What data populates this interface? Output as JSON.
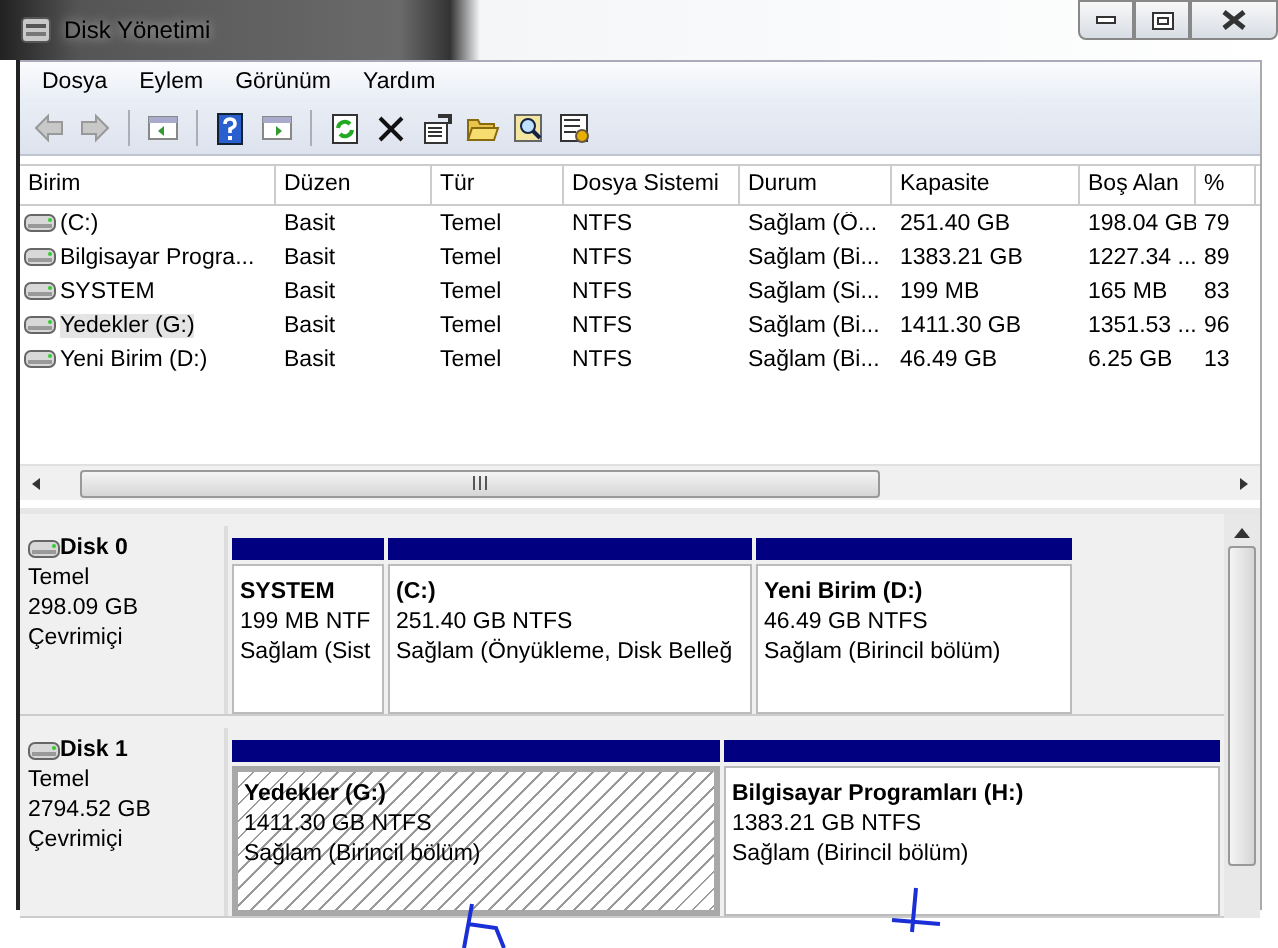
{
  "window": {
    "title": "Disk Yönetimi"
  },
  "menu": [
    "Dosya",
    "Eylem",
    "Görünüm",
    "Yardım"
  ],
  "table": {
    "columns": [
      "Birim",
      "Düzen",
      "Tür",
      "Dosya Sistemi",
      "Durum",
      "Kapasite",
      "Boş Alan",
      "%"
    ],
    "rows": [
      {
        "cells": [
          " (C:)",
          "Basit",
          "Temel",
          "NTFS",
          "Sağlam (Ö...",
          "251.40 GB",
          "198.04 GB",
          "79"
        ],
        "selected": false
      },
      {
        "cells": [
          "Bilgisayar Progra...",
          "Basit",
          "Temel",
          "NTFS",
          "Sağlam (Bi...",
          "1383.21 GB",
          "1227.34 ...",
          "89"
        ],
        "selected": false
      },
      {
        "cells": [
          "SYSTEM",
          "Basit",
          "Temel",
          "NTFS",
          "Sağlam (Si...",
          "199 MB",
          "165 MB",
          "83"
        ],
        "selected": false
      },
      {
        "cells": [
          "Yedekler (G:)",
          "Basit",
          "Temel",
          "NTFS",
          "Sağlam (Bi...",
          "1411.30 GB",
          "1351.53 ...",
          "96"
        ],
        "selected": true
      },
      {
        "cells": [
          "Yeni Birim (D:)",
          "Basit",
          "Temel",
          "NTFS",
          "Sağlam (Bi...",
          "46.49 GB",
          "6.25 GB",
          "13"
        ],
        "selected": false
      }
    ]
  },
  "disks": [
    {
      "name": "Disk 0",
      "type": "Temel",
      "size": "298.09 GB",
      "status": "Çevrimiçi",
      "partitions": [
        {
          "title": "SYSTEM",
          "size": "199 MB NTF",
          "status": "Sağlam (Sist",
          "selected": false
        },
        {
          "title": " (C:)",
          "size": "251.40 GB NTFS",
          "status": "Sağlam (Önyükleme, Disk Belleğ",
          "selected": false
        },
        {
          "title": "Yeni Birim  (D:)",
          "size": "46.49 GB NTFS",
          "status": "Sağlam (Birincil bölüm)",
          "selected": false
        }
      ]
    },
    {
      "name": "Disk 1",
      "type": "Temel",
      "size": "2794.52 GB",
      "status": "Çevrimiçi",
      "partitions": [
        {
          "title": "Yedekler  (G:)",
          "size": "1411.30 GB NTFS",
          "status": "Sağlam (Birincil bölüm)",
          "selected": true
        },
        {
          "title": "Bilgisayar Programları  (H:)",
          "size": "1383.21 GB NTFS",
          "status": "Sağlam (Birincil bölüm)",
          "selected": false
        }
      ]
    }
  ]
}
